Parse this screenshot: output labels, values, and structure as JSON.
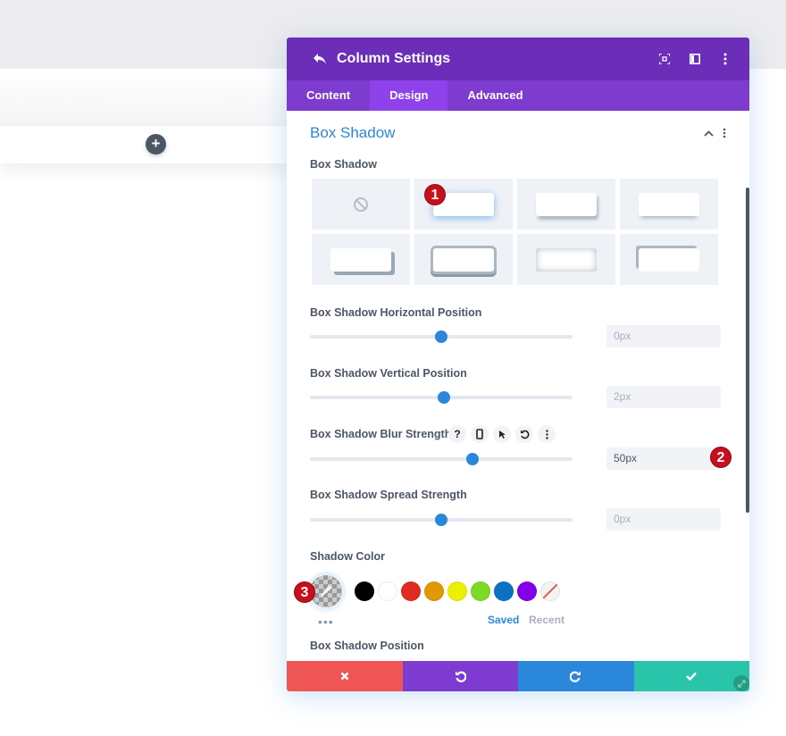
{
  "modal": {
    "title": "Column Settings",
    "tabs": [
      {
        "label": "Content",
        "active": false
      },
      {
        "label": "Design",
        "active": true
      },
      {
        "label": "Advanced",
        "active": false
      }
    ]
  },
  "section": {
    "title": "Box Shadow",
    "box_shadow_label": "Box Shadow",
    "presets": [
      "none",
      "preset-1",
      "preset-2",
      "preset-3",
      "preset-4",
      "preset-5",
      "preset-6",
      "preset-7"
    ],
    "selected_preset": "preset-1"
  },
  "fields": {
    "horizontal": {
      "label": "Box Shadow Horizontal Position",
      "value": "0px",
      "slider_percent": 50
    },
    "vertical": {
      "label": "Box Shadow Vertical Position",
      "value": "2px",
      "slider_percent": 51
    },
    "blur": {
      "label": "Box Shadow Blur Strength",
      "value": "50px",
      "slider_percent": 62
    },
    "spread": {
      "label": "Box Shadow Spread Strength",
      "value": "0px",
      "slider_percent": 50
    }
  },
  "shadow_color": {
    "label": "Shadow Color",
    "swatches": [
      "#000000",
      "#ffffff",
      "#e02b20",
      "#e09900",
      "#edf000",
      "#7cda24",
      "#0c71c3",
      "#8300e9"
    ],
    "more_label": "•••",
    "saved_label": "Saved",
    "recent_label": "Recent"
  },
  "next_label": "Box Shadow Position",
  "annotations": [
    "1",
    "2",
    "3"
  ],
  "colors": {
    "header": "#6c2eb9",
    "tabs": "#7e3bd0",
    "accent": "#2b87da",
    "cancel": "#ef5555",
    "undo": "#7e3bd0",
    "redo": "#2b87da",
    "save": "#29c4a9"
  }
}
